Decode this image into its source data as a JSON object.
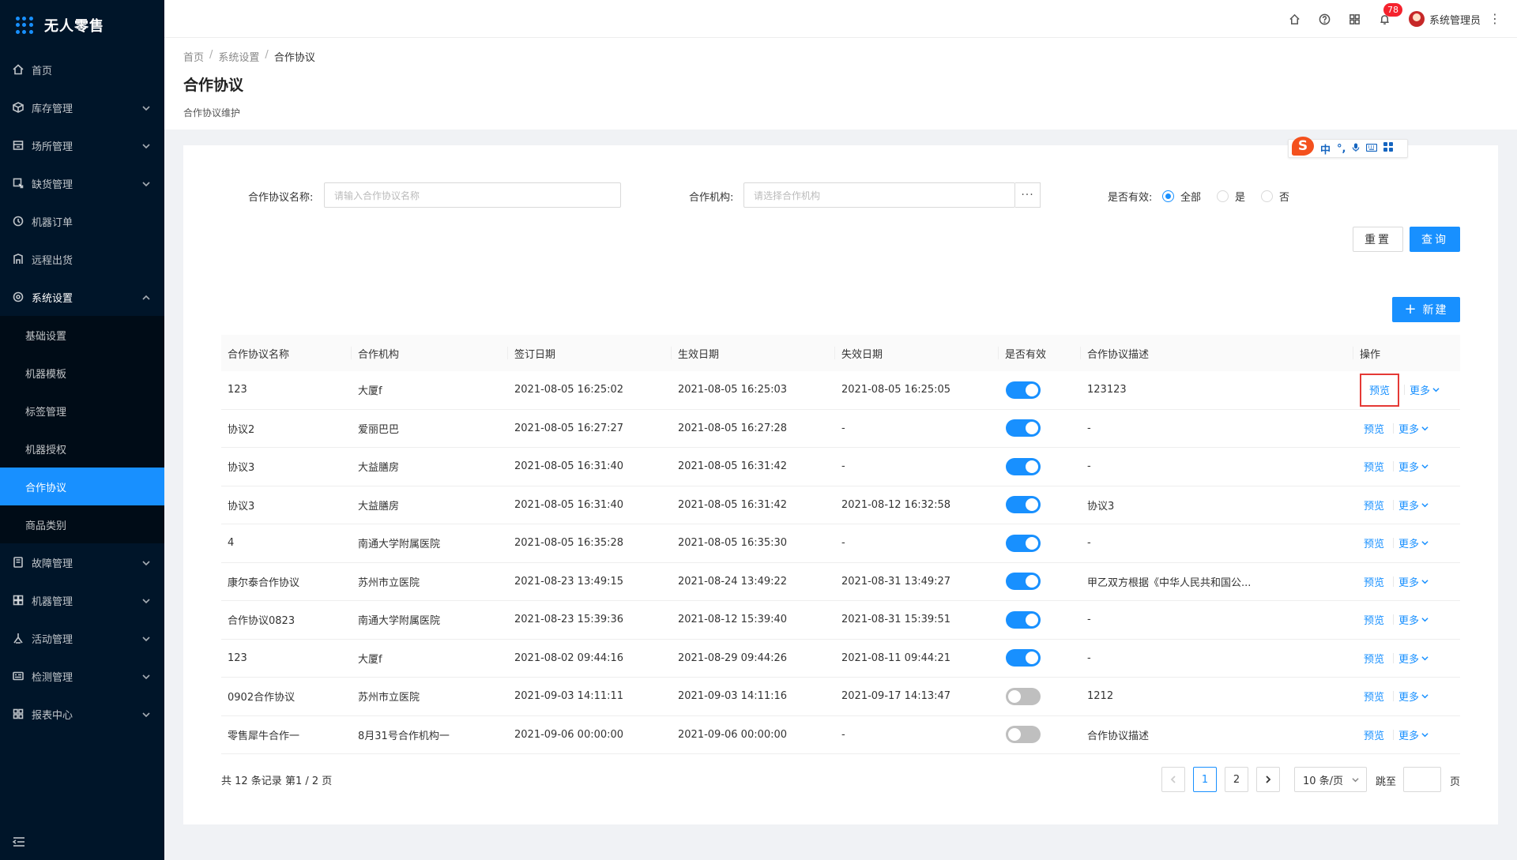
{
  "app": {
    "title": "无人零售"
  },
  "sidebar": {
    "items": [
      {
        "label": "首页",
        "icon": "home-icon",
        "has_children": false
      },
      {
        "label": "库存管理",
        "icon": "inventory-icon",
        "has_children": true
      },
      {
        "label": "场所管理",
        "icon": "venue-icon",
        "has_children": true
      },
      {
        "label": "缺货管理",
        "icon": "shortage-icon",
        "has_children": true
      },
      {
        "label": "机器订单",
        "icon": "order-icon",
        "has_children": false
      },
      {
        "label": "远程出货",
        "icon": "remote-icon",
        "has_children": false
      },
      {
        "label": "系统设置",
        "icon": "settings-icon",
        "has_children": true,
        "expanded": true
      }
    ],
    "system_sub_items": [
      "基础设置",
      "机器模板",
      "标签管理",
      "机器授权",
      "合作协议",
      "商品类别"
    ],
    "active_sub_item": "合作协议",
    "items_after": [
      {
        "label": "故障管理",
        "icon": "fault-icon"
      },
      {
        "label": "机器管理",
        "icon": "machine-icon"
      },
      {
        "label": "活动管理",
        "icon": "activity-icon"
      },
      {
        "label": "检测管理",
        "icon": "inspection-icon"
      },
      {
        "label": "报表中心",
        "icon": "report-icon"
      }
    ]
  },
  "header": {
    "notification_count": "78",
    "username": "系统管理员"
  },
  "breadcrumb": [
    "首页",
    "系统设置",
    "合作协议"
  ],
  "page": {
    "title": "合作协议",
    "description": "合作协议维护"
  },
  "ime": {
    "items": [
      "中",
      "°,"
    ]
  },
  "filter": {
    "name_label": "合作协议名称:",
    "name_placeholder": "请输入合作协议名称",
    "org_label": "合作机构:",
    "org_placeholder": "请选择合作机构",
    "org_picker": "···",
    "valid_label": "是否有效:",
    "valid_options": [
      "全部",
      "是",
      "否"
    ],
    "valid_selected": "全部",
    "reset_label": "重置",
    "query_label": "查询",
    "new_label": "新建"
  },
  "table": {
    "columns": [
      "合作协议名称",
      "合作机构",
      "签订日期",
      "生效日期",
      "失效日期",
      "是否有效",
      "合作协议描述",
      "操作"
    ],
    "rows": [
      {
        "name": "123",
        "org": "大厦f",
        "signed": "2021-08-05 16:25:02",
        "effective": "2021-08-05 16:25:03",
        "expiry": "2021-08-05 16:25:05",
        "valid": true,
        "desc": "123123"
      },
      {
        "name": "协议2",
        "org": "爱丽巴巴",
        "signed": "2021-08-05 16:27:27",
        "effective": "2021-08-05 16:27:28",
        "expiry": "-",
        "valid": true,
        "desc": "-"
      },
      {
        "name": "协议3",
        "org": "大益膳房",
        "signed": "2021-08-05 16:31:40",
        "effective": "2021-08-05 16:31:42",
        "expiry": "-",
        "valid": true,
        "desc": "-"
      },
      {
        "name": "协议3",
        "org": "大益膳房",
        "signed": "2021-08-05 16:31:40",
        "effective": "2021-08-05 16:31:42",
        "expiry": "2021-08-12 16:32:58",
        "valid": true,
        "desc": "协议3"
      },
      {
        "name": "4",
        "org": "南通大学附属医院",
        "signed": "2021-08-05 16:35:28",
        "effective": "2021-08-05 16:35:30",
        "expiry": "-",
        "valid": true,
        "desc": "-"
      },
      {
        "name": "康尔泰合作协议",
        "org": "苏州市立医院",
        "signed": "2021-08-23 13:49:15",
        "effective": "2021-08-24 13:49:22",
        "expiry": "2021-08-31 13:49:27",
        "valid": true,
        "desc": "甲乙双方根据《中华人民共和国公..."
      },
      {
        "name": "合作协议0823",
        "org": "南通大学附属医院",
        "signed": "2021-08-23 15:39:36",
        "effective": "2021-08-12 15:39:40",
        "expiry": "2021-08-31 15:39:51",
        "valid": true,
        "desc": "-"
      },
      {
        "name": "123",
        "org": "大厦f",
        "signed": "2021-08-02 09:44:16",
        "effective": "2021-08-29 09:44:26",
        "expiry": "2021-08-11 09:44:21",
        "valid": true,
        "desc": "-"
      },
      {
        "name": "0902合作协议",
        "org": "苏州市立医院",
        "signed": "2021-09-03 14:11:11",
        "effective": "2021-09-03 14:11:16",
        "expiry": "2021-09-17 14:13:47",
        "valid": false,
        "desc": "1212"
      },
      {
        "name": "零售犀牛合作一",
        "org": "8月31号合作机构一",
        "signed": "2021-09-06 00:00:00",
        "effective": "2021-09-06 00:00:00",
        "expiry": "-",
        "valid": false,
        "desc": "合作协议描述"
      }
    ],
    "op_preview": "预览",
    "op_more": "更多"
  },
  "pagination": {
    "summary": "共 12 条记录 第1 / 2 页",
    "pages": [
      "1",
      "2"
    ],
    "current": "1",
    "page_size": "10 条/页",
    "jump_label": "跳至",
    "page_suffix": "页"
  }
}
